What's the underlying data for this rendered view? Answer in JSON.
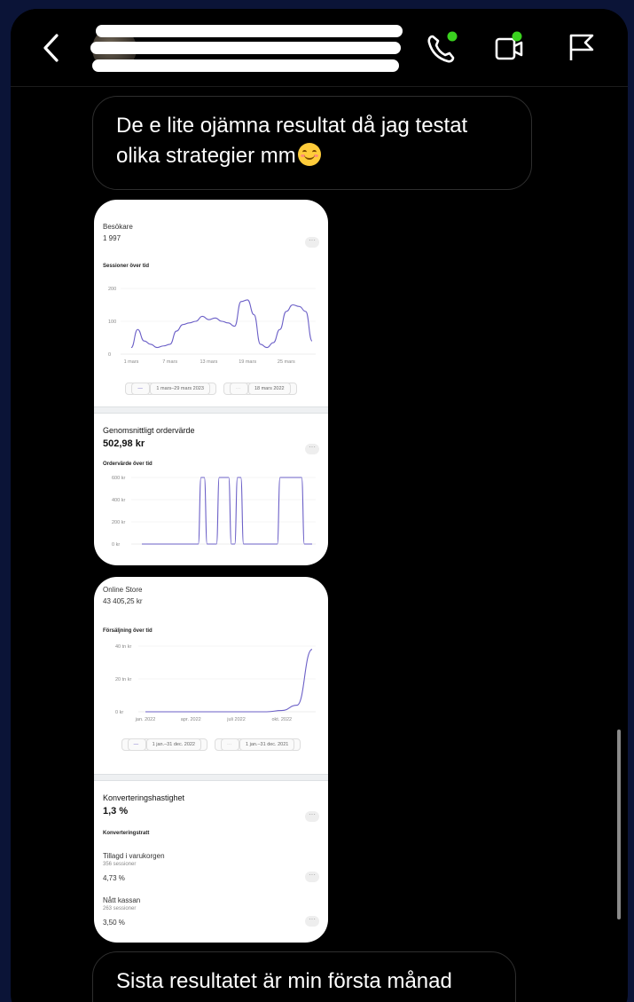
{
  "header": {
    "back_icon": "chevron-left-icon",
    "call_icon": "phone-icon",
    "video_icon": "video-camera-icon",
    "flag_icon": "flag-icon",
    "online_dot_color": "#3ad11f"
  },
  "messages": {
    "first": "De e lite ojämna resultat då jag testat olika strategier mm",
    "last": "Sista resultatet är min första månad"
  },
  "card1": {
    "visitors_label": "Besökare",
    "visitors_value": "1 997",
    "sessions_title": "Sessioner över tid",
    "legend_current": "1 mars–29 mars 2023",
    "legend_previous": "18 mars 2022",
    "aov_title": "Genomsnittligt ordervärde",
    "aov_value": "502,98 kr",
    "aov_chart_title": "Ordervärde över tid",
    "more": "···"
  },
  "card2": {
    "store_label": "Online Store",
    "store_value": "43 405,25 kr",
    "sales_title": "Försäljning över tid",
    "legend_current": "1 jan.–31 dec. 2022",
    "legend_previous": "1 jan.–31 dec. 2021",
    "conv_title": "Konverteringshastighet",
    "conv_value": "1,3 %",
    "funnel_title": "Konverteringstratt",
    "step1_label": "Tillagd i varukorgen",
    "step1_sessions": "356 sessioner",
    "step1_pct": "4,73 %",
    "step2_label": "Nått kassan",
    "step2_sessions": "263 sessioner",
    "step2_pct": "3,50 %",
    "more": "···"
  },
  "chart_data": [
    {
      "type": "line",
      "title": "Sessioner över tid",
      "x_ticks": [
        "1 mars",
        "7 mars",
        "13 mars",
        "19 mars",
        "25 mars"
      ],
      "y_ticks": [
        "0",
        "100",
        "200"
      ],
      "ylim": [
        0,
        200
      ],
      "x": [
        1,
        2,
        3,
        4,
        5,
        6,
        7,
        8,
        9,
        10,
        11,
        12,
        13,
        14,
        15,
        16,
        17,
        18,
        19,
        20,
        21,
        22,
        23,
        24,
        25,
        26,
        27,
        28,
        29
      ],
      "series": [
        {
          "name": "1 mars–29 mars 2023",
          "values": [
            20,
            75,
            40,
            30,
            20,
            25,
            30,
            70,
            90,
            95,
            100,
            115,
            105,
            110,
            100,
            95,
            85,
            160,
            165,
            120,
            30,
            20,
            35,
            75,
            130,
            150,
            145,
            130,
            40
          ]
        }
      ]
    },
    {
      "type": "line",
      "title": "Ordervärde över tid",
      "y_ticks": [
        "0 kr",
        "200 kr",
        "400 kr",
        "600 kr"
      ],
      "ylim": [
        0,
        600
      ],
      "x": [
        1,
        2,
        3,
        4,
        5,
        6,
        7,
        8,
        9,
        10,
        11,
        12,
        13,
        14,
        15,
        16,
        17,
        18,
        19,
        20,
        21,
        22,
        23,
        24,
        25,
        26,
        27,
        28,
        29
      ],
      "series": [
        {
          "name": "1 mars–29 mars 2023",
          "values": [
            0,
            0,
            0,
            0,
            0,
            0,
            0,
            0,
            0,
            0,
            600,
            0,
            0,
            600,
            600,
            0,
            600,
            0,
            0,
            0,
            0,
            0,
            0,
            600,
            600,
            600,
            600,
            0,
            0
          ]
        }
      ]
    },
    {
      "type": "line",
      "title": "Försäljning över tid",
      "x_ticks": [
        "jan. 2022",
        "apr. 2022",
        "juli 2022",
        "okt. 2022"
      ],
      "y_ticks": [
        "0 kr",
        "20 tn kr",
        "40 tn kr"
      ],
      "ylim": [
        0,
        40000
      ],
      "x": [
        1,
        2,
        3,
        4,
        5,
        6,
        7,
        8,
        9,
        10,
        11,
        12
      ],
      "series": [
        {
          "name": "1 jan.–31 dec. 2022",
          "values": [
            0,
            0,
            0,
            0,
            0,
            0,
            0,
            0,
            0,
            800,
            4000,
            38000
          ]
        }
      ]
    }
  ]
}
